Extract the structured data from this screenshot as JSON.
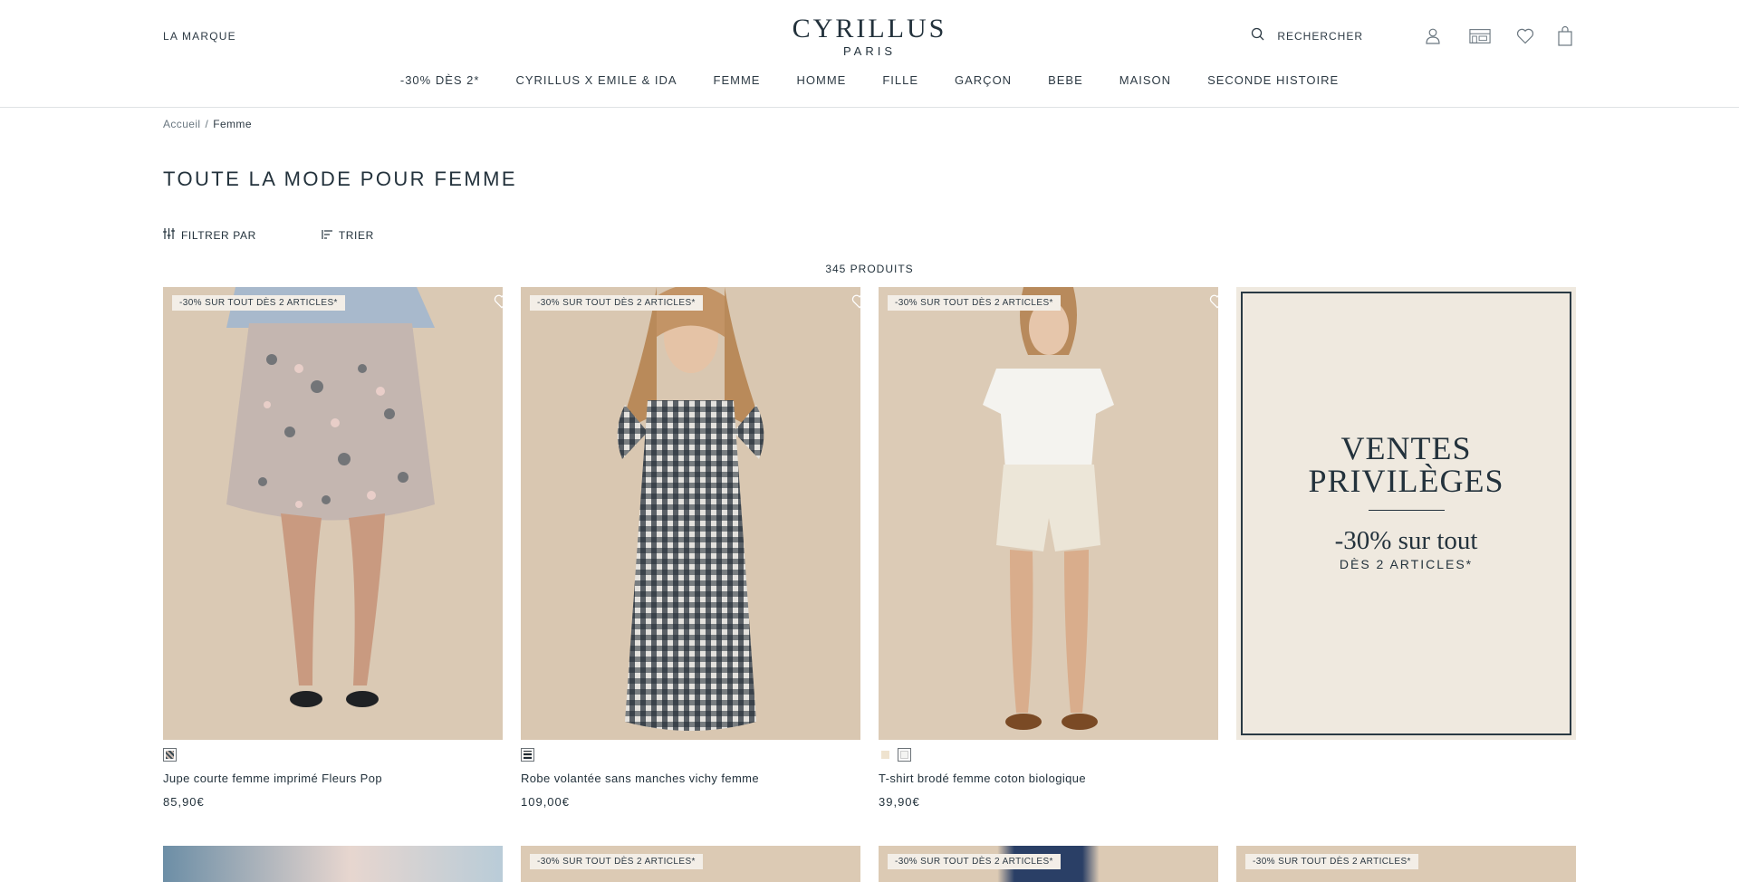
{
  "header": {
    "brand_link": "LA MARQUE",
    "logo_main": "CYRILLUS",
    "logo_sub": "PARIS",
    "search_label": "RECHERCHER",
    "icons": [
      "search-icon",
      "account-icon",
      "store-icon",
      "wishlist-icon",
      "bag-icon"
    ]
  },
  "nav": {
    "items": [
      "-30% DÈS 2*",
      "CYRILLUS X EMILE & IDA",
      "FEMME",
      "HOMME",
      "FILLE",
      "GARÇON",
      "BEBE",
      "MAISON",
      "SECONDE HISTOIRE"
    ]
  },
  "breadcrumb": {
    "home": "Accueil",
    "separator": "/",
    "current": "Femme"
  },
  "page": {
    "title": "TOUTE LA MODE POUR FEMME",
    "filter_label": "FILTRER PAR",
    "sort_label": "TRIER",
    "count": "345 PRODUITS"
  },
  "products": [
    {
      "badge": "-30% SUR TOUT DÈS 2 ARTICLES*",
      "name": "Jupe courte femme imprimé Fleurs Pop",
      "price": "85,90€",
      "swatches": [
        "#3a4a52"
      ]
    },
    {
      "badge": "-30% SUR TOUT DÈS 2 ARTICLES*",
      "name": "Robe volantée sans manches vichy femme",
      "price": "109,00€",
      "swatches": [
        "#1f2a33"
      ]
    },
    {
      "badge": "-30% SUR TOUT DÈS 2 ARTICLES*",
      "name": "T-shirt brodé femme coton biologique",
      "price": "39,90€",
      "swatches": [
        "#efe3cf",
        "#f4f4f2"
      ]
    }
  ],
  "promo": {
    "title_line1": "VENTES",
    "title_line2": "PRIVILÈGES",
    "subtitle": "-30% sur tout",
    "subtitle2": "DÈS 2 ARTICLES*"
  },
  "row2_badges": [
    "",
    "-30% SUR TOUT DÈS 2 ARTICLES*",
    "-30% SUR TOUT DÈS 2 ARTICLES*",
    "-30% SUR TOUT DÈS 2 ARTICLES*"
  ],
  "colors": {
    "text": "#23323c",
    "badge_bg": "#f3eee7",
    "promo_bg": "#efe9df",
    "image_bg": "#dccdbb"
  }
}
